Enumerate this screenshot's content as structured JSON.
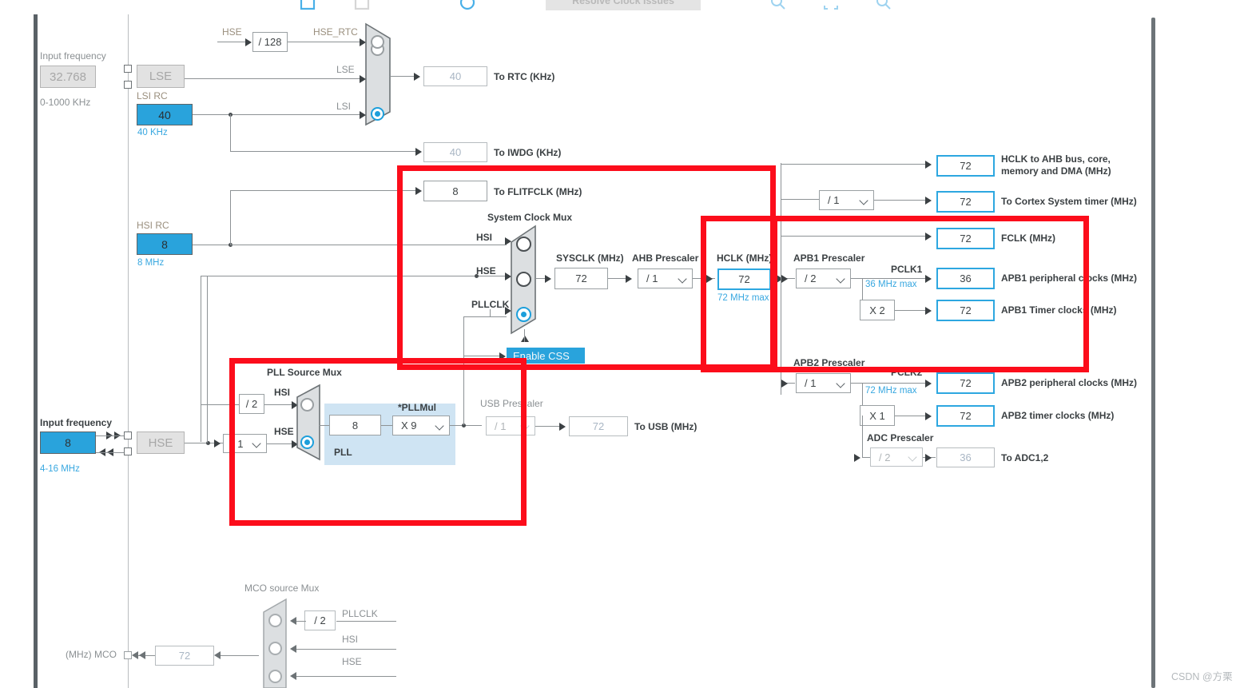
{
  "toolbar": {
    "resolve_button_label": "Resolve Clock Issues",
    "icons": [
      "panel-icon",
      "panel-collapse-icon",
      "refresh-icon",
      "zoom-in-icon",
      "fit-screen-icon",
      "zoom-out-icon"
    ]
  },
  "watermark": "CSDN @方栗",
  "lse": {
    "input_frequency_label": "Input frequency",
    "value": "32.768",
    "range": "0-1000 KHz",
    "osc_label": "LSE"
  },
  "lsi": {
    "label": "LSI RC",
    "value": "40",
    "unit": "40 KHz"
  },
  "hsi": {
    "label": "HSI RC",
    "value": "8",
    "unit": "8 MHz"
  },
  "hse": {
    "input_frequency_label": "Input frequency",
    "value": "8",
    "range": "4-16 MHz",
    "osc_label": "HSE",
    "prescaler": "/ 1",
    "div128": "/ 128",
    "div128_in_label": "HSE",
    "div128_out_label": "HSE_RTC"
  },
  "rtc_mux": {
    "inputs": [
      "LSE",
      "LSI"
    ],
    "selected": 1
  },
  "outputs": {
    "to_rtc": {
      "value": "40",
      "label": "To RTC (KHz)"
    },
    "to_iwdg": {
      "value": "40",
      "label": "To IWDG (KHz)"
    },
    "to_flitfclk": {
      "value": "8",
      "label": "To FLITFCLK (MHz)"
    },
    "to_usb": {
      "value": "72",
      "label": "To USB (MHz)"
    },
    "hclk_ahb": {
      "value": "72",
      "label": "HCLK to AHB bus, core, memory and DMA (MHz)"
    },
    "cortex_systimer": {
      "value": "72",
      "label": "To Cortex System timer (MHz)"
    },
    "fclk": {
      "value": "72",
      "label": "FCLK (MHz)"
    },
    "apb1_periph": {
      "value": "36",
      "label": "APB1 peripheral clocks (MHz)"
    },
    "apb1_timer": {
      "value": "72",
      "label": "APB1 Timer clocks (MHz)"
    },
    "apb2_periph": {
      "value": "72",
      "label": "APB2 peripheral clocks (MHz)"
    },
    "apb2_timer": {
      "value": "72",
      "label": "APB2 timer clocks (MHz)"
    },
    "to_adc": {
      "value": "36",
      "label": "To ADC1,2"
    },
    "mco": {
      "value": "72",
      "label": "(MHz) MCO"
    }
  },
  "system_clock_mux": {
    "title": "System Clock Mux",
    "inputs": [
      "HSI",
      "HSE",
      "PLLCLK"
    ],
    "selected": 2,
    "css_label": "Enable CSS"
  },
  "sysclk": {
    "label": "SYSCLK (MHz)",
    "value": "72"
  },
  "ahb_prescaler": {
    "label": "AHB Prescaler",
    "value": "/ 1"
  },
  "hclk": {
    "label": "HCLK (MHz)",
    "value": "72",
    "max": "72 MHz max"
  },
  "cortex_prescaler": {
    "value": "/ 1"
  },
  "apb1": {
    "label": "APB1 Prescaler",
    "value": "/ 2",
    "pclk_label": "PCLK1",
    "max": "36 MHz max",
    "timer_mult": "X 2"
  },
  "apb2": {
    "label": "APB2 Prescaler",
    "value": "/ 1",
    "pclk_label": "PCLK2",
    "max": "72 MHz max",
    "timer_mult": "X 1"
  },
  "adc_prescaler": {
    "label": "ADC Prescaler",
    "value": "/ 2"
  },
  "pll": {
    "mux_title": "PLL Source Mux",
    "inputs": [
      "HSI",
      "HSE"
    ],
    "selected": 1,
    "hsi_div": "/ 2",
    "source_value": "8",
    "mul_label": "*PLLMul",
    "mul_value": "X 9",
    "group_label": "PLL"
  },
  "usb_prescaler": {
    "label": "USB Prescaler",
    "value": "/ 1"
  },
  "mco_mux": {
    "title": "MCO source Mux",
    "inputs": [
      "PLLCLK",
      "HSI",
      "HSE"
    ],
    "pllclk_div": "/ 2"
  },
  "colors": {
    "accent_blue": "#29a3dc",
    "annotation_red": "#fc0d1b",
    "wire": "#8d9295",
    "box_border": "#9aa0a3"
  }
}
